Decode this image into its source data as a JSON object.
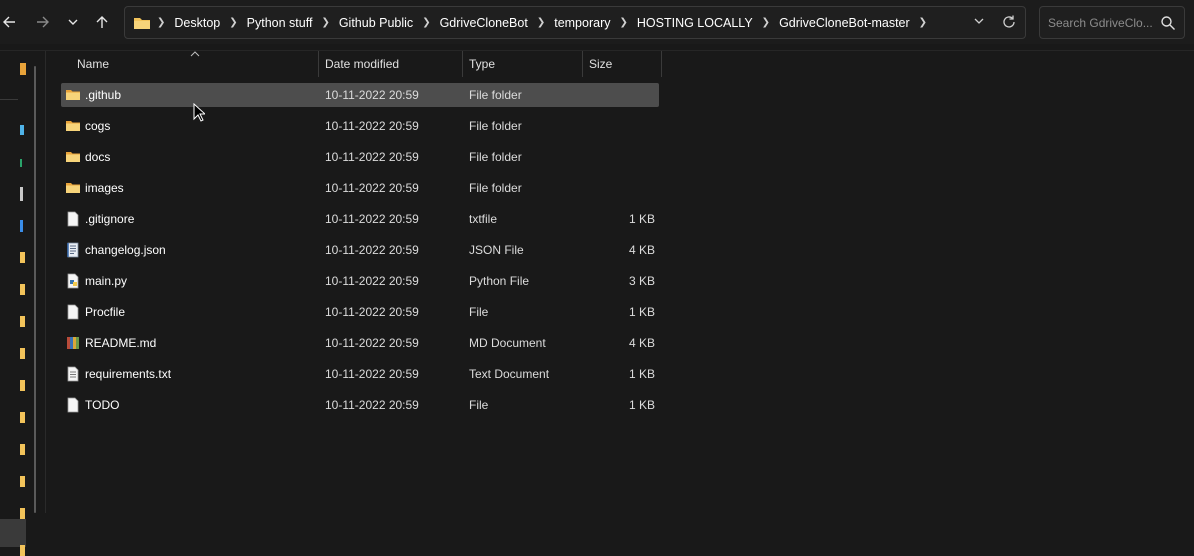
{
  "toolbar": {
    "back_icon": "arrow-left-icon",
    "forward_icon": "arrow-right-icon",
    "recent_icon": "chevron-down-icon",
    "up_icon": "arrow-up-icon"
  },
  "address": {
    "crumbs": [
      "Desktop",
      "Python stuff",
      "Github Public",
      "GdriveCloneBot",
      "temporary",
      "HOSTING LOCALLY",
      "GdriveCloneBot-master"
    ],
    "dropdown_icon": "chevron-down-icon",
    "refresh_icon": "refresh-icon"
  },
  "search": {
    "placeholder": "Search GdriveClo..."
  },
  "columns": {
    "name": "Name",
    "date": "Date modified",
    "type": "Type",
    "size": "Size"
  },
  "files": [
    {
      "name": ".github",
      "date": "10-11-2022 20:59",
      "type": "File folder",
      "size": "",
      "icon": "folder-icon",
      "selected": true
    },
    {
      "name": "cogs",
      "date": "10-11-2022 20:59",
      "type": "File folder",
      "size": "",
      "icon": "folder-icon"
    },
    {
      "name": "docs",
      "date": "10-11-2022 20:59",
      "type": "File folder",
      "size": "",
      "icon": "folder-icon"
    },
    {
      "name": "images",
      "date": "10-11-2022 20:59",
      "type": "File folder",
      "size": "",
      "icon": "folder-icon"
    },
    {
      "name": ".gitignore",
      "date": "10-11-2022 20:59",
      "type": "txtfile",
      "size": "1 KB",
      "icon": "file-icon"
    },
    {
      "name": "changelog.json",
      "date": "10-11-2022 20:59",
      "type": "JSON File",
      "size": "4 KB",
      "icon": "json-file-icon"
    },
    {
      "name": "main.py",
      "date": "10-11-2022 20:59",
      "type": "Python File",
      "size": "3 KB",
      "icon": "python-file-icon"
    },
    {
      "name": "Procfile",
      "date": "10-11-2022 20:59",
      "type": "File",
      "size": "1 KB",
      "icon": "file-icon"
    },
    {
      "name": "README.md",
      "date": "10-11-2022 20:59",
      "type": "MD Document",
      "size": "4 KB",
      "icon": "md-file-icon"
    },
    {
      "name": "requirements.txt",
      "date": "10-11-2022 20:59",
      "type": "Text Document",
      "size": "1 KB",
      "icon": "text-file-icon"
    },
    {
      "name": "TODO",
      "date": "10-11-2022 20:59",
      "type": "File",
      "size": "1 KB",
      "icon": "file-icon"
    }
  ],
  "colors": {
    "background": "#191919",
    "selected_row": "#4d4d4d",
    "folder": "#f2c35a"
  }
}
